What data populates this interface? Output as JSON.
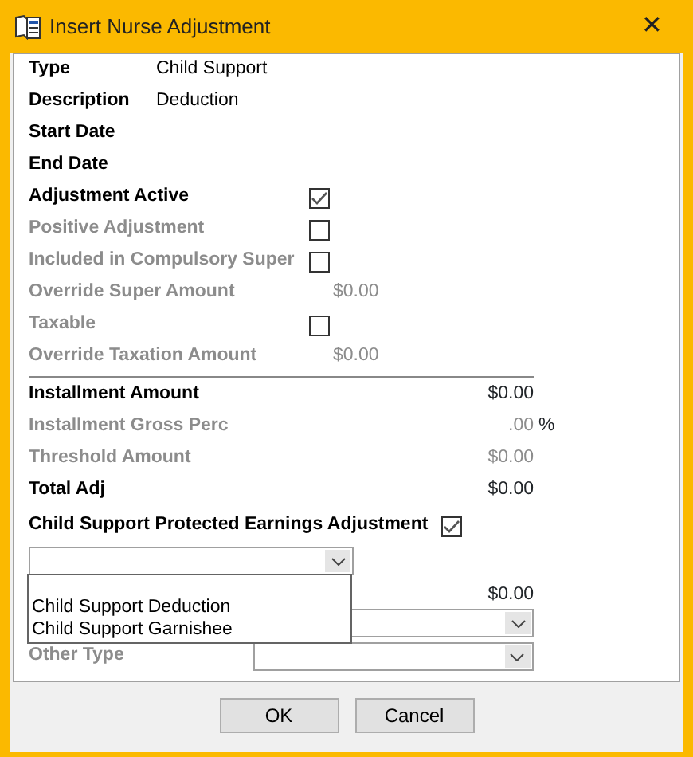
{
  "window": {
    "title": "Insert Nurse Adjustment",
    "close": "✕"
  },
  "fields": [
    {
      "kind": "text",
      "label": "Type",
      "value": "Child Support"
    },
    {
      "kind": "text",
      "label": "Description",
      "value": "Deduction"
    },
    {
      "kind": "text",
      "label": "Start Date"
    },
    {
      "kind": "text",
      "label": "End Date"
    },
    {
      "kind": "checkbox",
      "label": "Adjustment Active",
      "disabled": false,
      "checked": true
    },
    {
      "kind": "checkbox",
      "label": "Positive Adjustment",
      "disabled": true,
      "checked": false
    },
    {
      "kind": "checkbox",
      "label": "Included in Compulsory Super",
      "disabled": true,
      "checked": false
    },
    {
      "kind": "amount",
      "label": "Override Super Amount",
      "disabled": true,
      "value": "$0.00"
    },
    {
      "kind": "checkbox",
      "label": "Taxable",
      "disabled": true,
      "checked": false
    },
    {
      "kind": "amount",
      "label": "Override Taxation Amount",
      "disabled": true,
      "value": "$0.00"
    }
  ],
  "totals": [
    {
      "label": "Installment Amount",
      "disabled": false,
      "value": "$0.00"
    },
    {
      "label": "Installment Gross Perc",
      "disabled": true,
      "value": ".00",
      "suffix": "%"
    },
    {
      "label": "Threshold Amount",
      "disabled": true,
      "value": "$0.00"
    },
    {
      "label": "Total Adj",
      "disabled": false,
      "value": "$0.00"
    }
  ],
  "protected_earnings": {
    "label": "Child Support Protected Earnings Adjustment",
    "checked": true
  },
  "type_combo": {
    "expanded": true,
    "options": [
      "Child Support Deduction",
      "Child Support Garnishee"
    ]
  },
  "covered_amount": "$0.00",
  "other_type": {
    "label": "Other Type",
    "disabled": true
  },
  "buttons": [
    "OK",
    "Cancel"
  ]
}
